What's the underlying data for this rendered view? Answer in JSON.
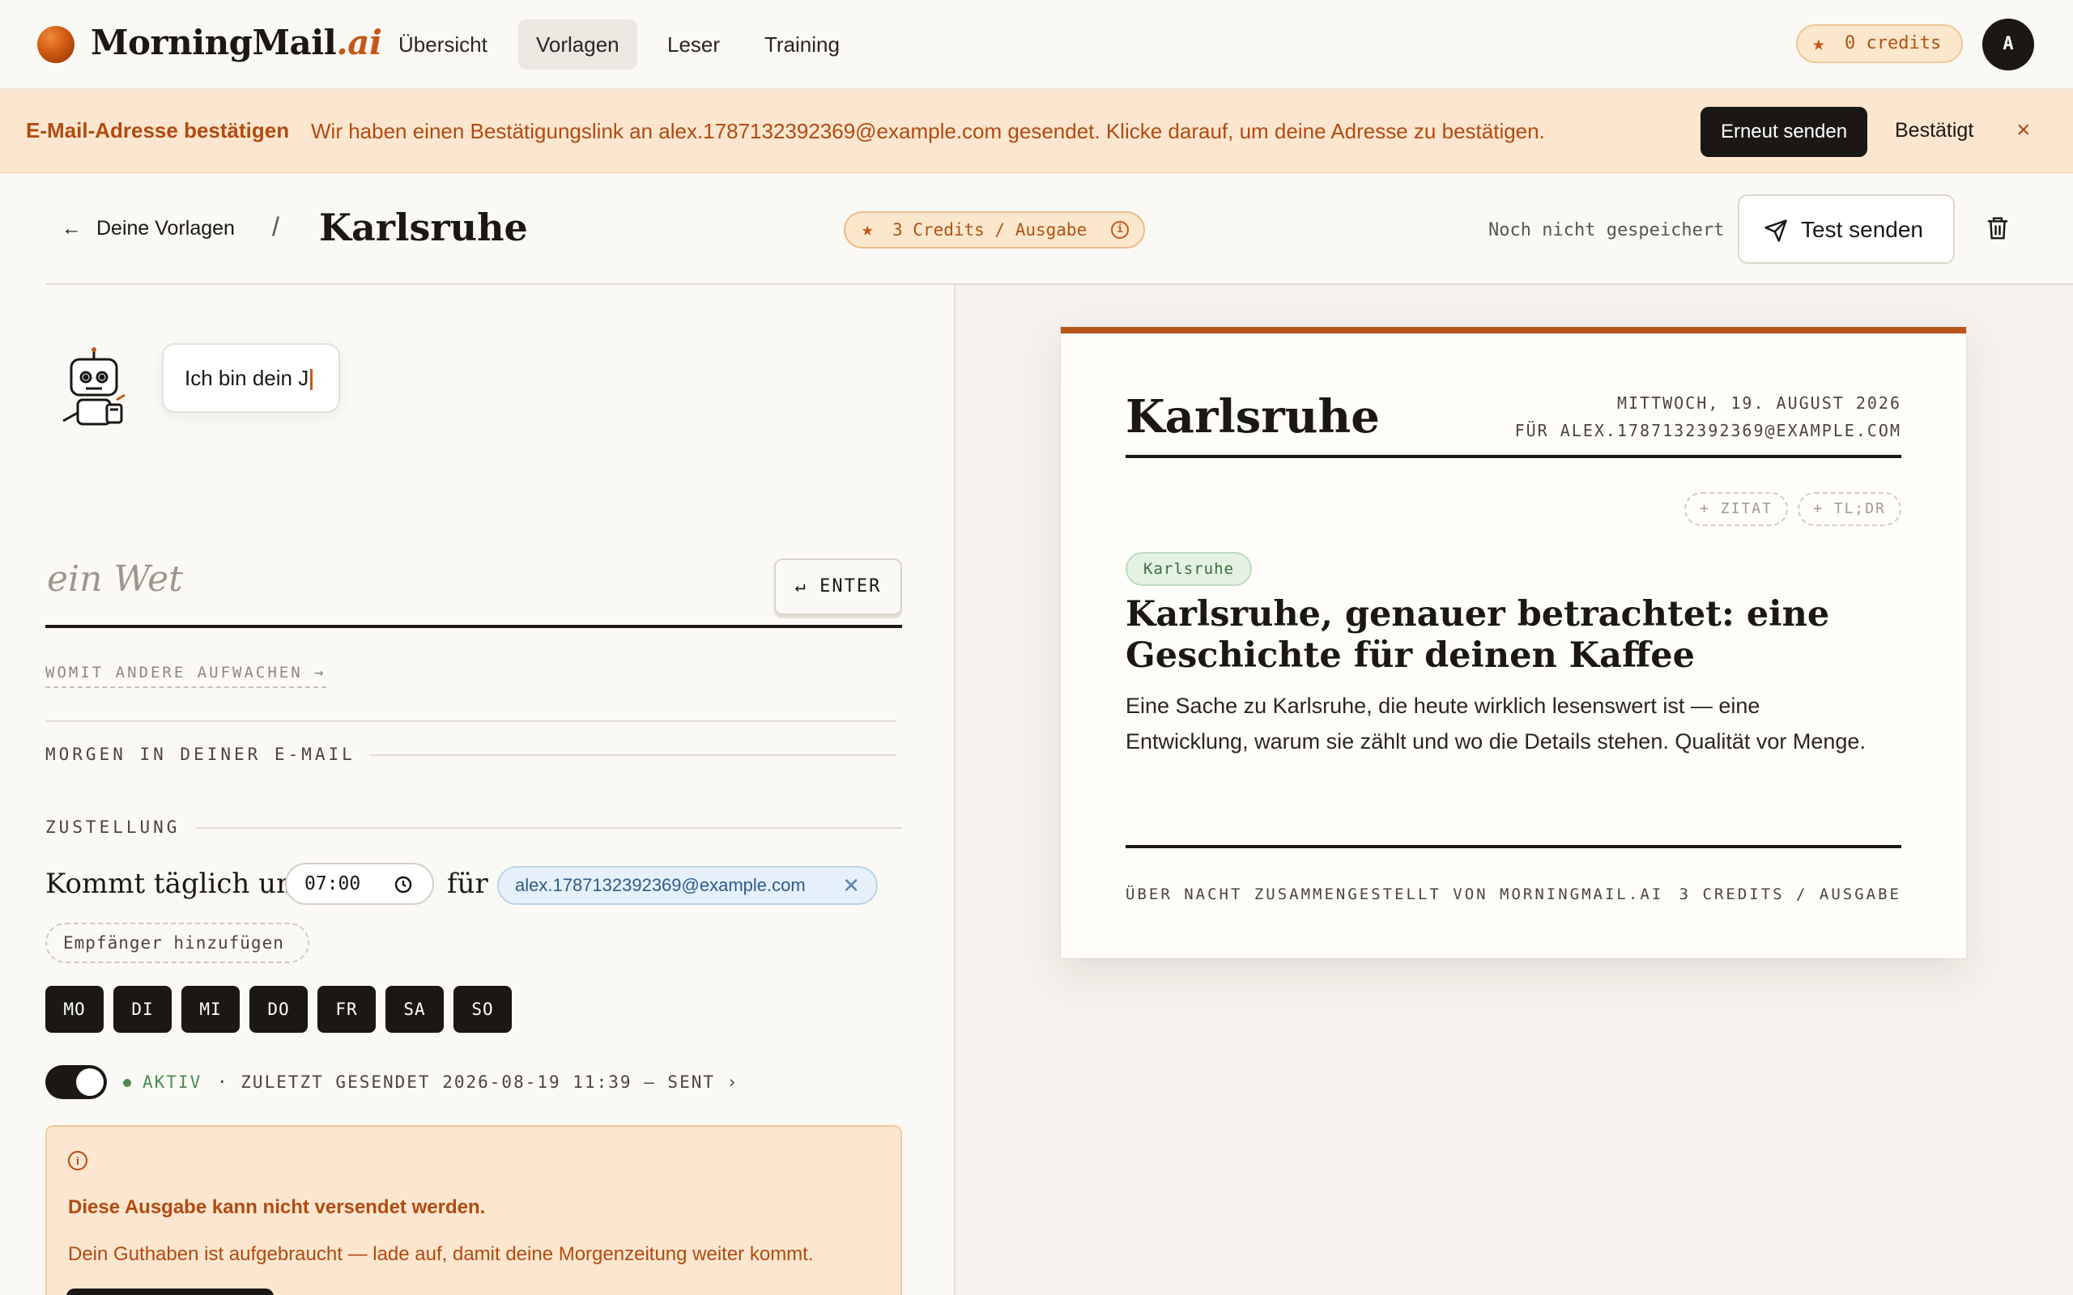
{
  "nav": {
    "brand_main": "MorningMail",
    "brand_suffix": ".ai",
    "items": [
      {
        "label": "Übersicht",
        "active": false
      },
      {
        "label": "Vorlagen",
        "active": true
      },
      {
        "label": "Leser",
        "active": false
      },
      {
        "label": "Training",
        "active": false
      }
    ],
    "credits": "0 credits",
    "avatar_initial": "A"
  },
  "banner": {
    "title": "E-Mail-Adresse bestätigen",
    "text": "Wir haben einen Bestätigungslink an alex.1787132392369@example.com gesendet. Klicke darauf, um deine Adresse zu bestätigen.",
    "resend_label": "Erneut senden",
    "confirmed_label": "Bestätigt",
    "close_glyph": "×"
  },
  "header": {
    "back_label": "Deine Vorlagen",
    "separator": "/",
    "title": "Karlsruhe",
    "cost_label": "3 Credits / Ausgabe",
    "save_status": "Noch nicht gespeichert",
    "test_label": "Test senden"
  },
  "editor": {
    "assistant_text": "Ich bin dein J",
    "prompt_text": "ein Wet",
    "enter_label": "↵ ENTER",
    "others_link": "WOMIT ANDERE AUFWACHEN →",
    "section_tomorrow": "MORGEN IN DEINER E-MAIL",
    "section_delivery": "ZUSTELLUNG",
    "deliver_prefix": "Kommt täglich um",
    "time": "07:00",
    "for_label": "für",
    "recipient": "alex.1787132392369@example.com",
    "add_recipient": "Empfänger hinzufügen",
    "days": [
      "MO",
      "DI",
      "MI",
      "DO",
      "FR",
      "SA",
      "SO"
    ],
    "status_active": "AKTIV",
    "status_rest": "· ZULETZT GESENDET 2026-08-19 11:39 — SENT ›",
    "warning_title": "Diese Ausgabe kann nicht versendet werden.",
    "warning_text": "Dein Guthaben ist aufgebraucht — lade auf, damit deine Morgenzeitung weiter kommt."
  },
  "preview": {
    "title": "Karlsruhe",
    "date": "MITTWOCH, 19. AUGUST 2026",
    "for_line": "FÜR ALEX.1787132392369@EXAMPLE.COM",
    "add_quote": "+ ZITAT",
    "add_tldr": "+ TL;DR",
    "tag": "Karlsruhe",
    "headline": "Karlsruhe, genauer betrachtet: eine Geschichte für deinen Kaffee",
    "lead": "Eine Sache zu Karlsruhe, die heute wirklich lesenswert ist — eine Entwicklung, warum sie zählt und wo die Details stehen. Qualität vor Menge.",
    "footer_left": "ÜBER NACHT ZUSAMMENGESTELLT VON MORNINGMAIL.AI",
    "footer_right": "3 CREDITS / AUSGABE"
  },
  "colors": {
    "accent": "#c4581a",
    "banner_bg": "#fde6cf",
    "dark": "#1a1714",
    "active_green": "#4c8a52"
  },
  "icons": [
    "logo-dot-icon",
    "star-icon",
    "arrow-left-icon",
    "info-icon",
    "send-icon",
    "trash-icon",
    "robot-icon",
    "clock-icon",
    "close-icon"
  ]
}
